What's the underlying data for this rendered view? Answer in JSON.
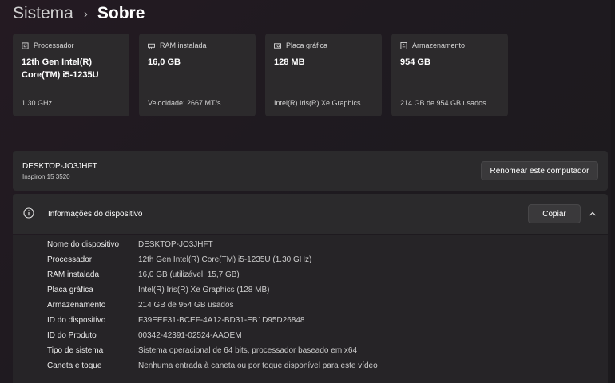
{
  "breadcrumb": {
    "parent": "Sistema",
    "separator": "›",
    "current": "Sobre"
  },
  "spec_cards": [
    {
      "icon": "processor-icon",
      "label": "Processador",
      "value": "12th Gen Intel(R) Core(TM) i5-1235U",
      "detail": "1.30 GHz"
    },
    {
      "icon": "ram-icon",
      "label": "RAM instalada",
      "value": "16,0 GB",
      "detail": "Velocidade: 2667 MT/s"
    },
    {
      "icon": "gpu-icon",
      "label": "Placa gráfica",
      "value": "128 MB",
      "detail": "Intel(R) Iris(R) Xe Graphics"
    },
    {
      "icon": "storage-icon",
      "label": "Armazenamento",
      "value": "954 GB",
      "detail": "214 GB de 954 GB usados"
    }
  ],
  "device": {
    "name": "DESKTOP-JO3JHFT",
    "model": "Inspiron 15 3520",
    "rename_label": "Renomear este computador"
  },
  "device_info": {
    "title": "Informações do dispositivo",
    "copy_label": "Copiar",
    "rows": [
      {
        "label": "Nome do dispositivo",
        "value": "DESKTOP-JO3JHFT"
      },
      {
        "label": "Processador",
        "value": "12th Gen Intel(R) Core(TM) i5-1235U (1.30 GHz)"
      },
      {
        "label": "RAM instalada",
        "value": "16,0 GB (utilizável: 15,7 GB)"
      },
      {
        "label": "Placa gráfica",
        "value": "Intel(R) Iris(R) Xe Graphics (128 MB)"
      },
      {
        "label": "Armazenamento",
        "value": "214 GB de 954 GB usados"
      },
      {
        "label": "ID do dispositivo",
        "value": "F39EEF31-BCEF-4A12-BD31-EB1D95D26848"
      },
      {
        "label": "ID do Produto",
        "value": "00342-42391-02524-AAOEM"
      },
      {
        "label": "Tipo de sistema",
        "value": "Sistema operacional de 64 bits, processador baseado em x64"
      },
      {
        "label": "Caneta e toque",
        "value": "Nenhuma entrada à caneta ou por toque disponível para este vídeo"
      }
    ]
  }
}
